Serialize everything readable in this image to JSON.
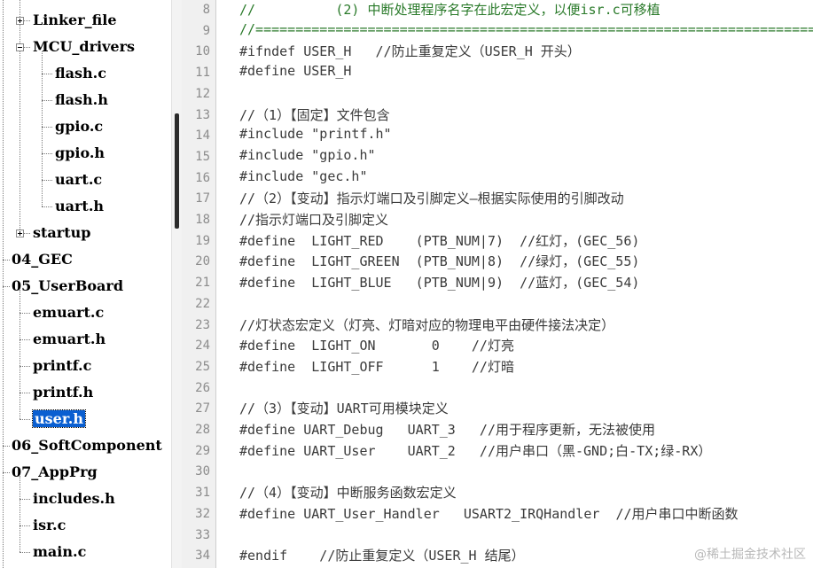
{
  "file_tree": {
    "items": [
      {
        "label": "Linker_file",
        "expand": "plus"
      },
      {
        "label": "MCU_drivers",
        "expand": "minus"
      },
      {
        "label": "flash.c"
      },
      {
        "label": "flash.h"
      },
      {
        "label": "gpio.c"
      },
      {
        "label": "gpio.h"
      },
      {
        "label": "uart.c"
      },
      {
        "label": "uart.h"
      },
      {
        "label": "startup",
        "expand": "plus"
      },
      {
        "label": "04_GEC"
      },
      {
        "label": "05_UserBoard"
      },
      {
        "label": "emuart.c"
      },
      {
        "label": "emuart.h"
      },
      {
        "label": "printf.c"
      },
      {
        "label": "printf.h"
      },
      {
        "label": "user.h",
        "selected": true
      },
      {
        "label": "06_SoftComponent"
      },
      {
        "label": "07_AppPrg"
      },
      {
        "label": "includes.h"
      },
      {
        "label": "isr.c"
      },
      {
        "label": "main.c"
      }
    ]
  },
  "editor": {
    "lines": [
      {
        "num": "8",
        "text": "//          (2) 中断处理程序名字在此宏定义，以便isr.c可移植",
        "comment": true
      },
      {
        "num": "9",
        "text": "//=======================================================================",
        "comment": true
      },
      {
        "num": "10",
        "text": "#ifndef USER_H   //防止重复定义（USER_H 开头）"
      },
      {
        "num": "11",
        "text": "#define USER_H"
      },
      {
        "num": "12",
        "text": ""
      },
      {
        "num": "13",
        "text": "//（1）【固定】文件包含"
      },
      {
        "num": "14",
        "text": "#include \"printf.h\""
      },
      {
        "num": "15",
        "text": "#include \"gpio.h\""
      },
      {
        "num": "16",
        "text": "#include \"gec.h\""
      },
      {
        "num": "17",
        "text": "//（2）【变动】指示灯端口及引脚定义—根据实际使用的引脚改动"
      },
      {
        "num": "18",
        "text": "//指示灯端口及引脚定义"
      },
      {
        "num": "19",
        "text": "#define  LIGHT_RED    (PTB_NUM|7)  //红灯，(GEC_56)"
      },
      {
        "num": "20",
        "text": "#define  LIGHT_GREEN  (PTB_NUM|8)  //绿灯，(GEC_55)"
      },
      {
        "num": "21",
        "text": "#define  LIGHT_BLUE   (PTB_NUM|9)  //蓝灯，(GEC_54)"
      },
      {
        "num": "22",
        "text": ""
      },
      {
        "num": "23",
        "text": "//灯状态宏定义（灯亮、灯暗对应的物理电平由硬件接法决定）"
      },
      {
        "num": "24",
        "text": "#define  LIGHT_ON       0    //灯亮"
      },
      {
        "num": "25",
        "text": "#define  LIGHT_OFF      1    //灯暗"
      },
      {
        "num": "26",
        "text": ""
      },
      {
        "num": "27",
        "text": "//（3）【变动】UART可用模块定义"
      },
      {
        "num": "28",
        "text": "#define UART_Debug   UART_3   //用于程序更新，无法被使用"
      },
      {
        "num": "29",
        "text": "#define UART_User    UART_2   //用户串口（黑-GND;白-TX;绿-RX）"
      },
      {
        "num": "30",
        "text": ""
      },
      {
        "num": "31",
        "text": "//（4）【变动】中断服务函数宏定义"
      },
      {
        "num": "32",
        "text": "#define UART_User_Handler   USART2_IRQHandler  //用户串口中断函数"
      },
      {
        "num": "33",
        "text": ""
      },
      {
        "num": "34",
        "text": "#endif    //防止重复定义（USER_H 结尾）"
      }
    ]
  },
  "watermark": "@稀土掘金技术社区",
  "colors": {
    "selection": "#0a5fd1",
    "comment_green": "#2a7a2a",
    "gutter_bg": "#f0f0f0"
  }
}
